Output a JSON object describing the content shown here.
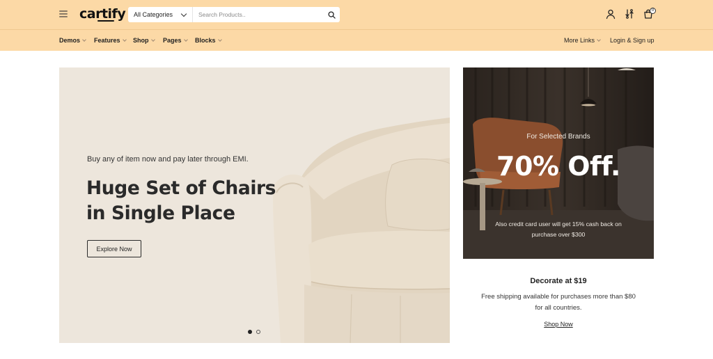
{
  "header": {
    "logo": "cartify",
    "category_select": "All Categories",
    "search_placeholder": "Search Products..",
    "cart_count": "0"
  },
  "nav": {
    "left": [
      {
        "label": "Demos"
      },
      {
        "label": "Features"
      },
      {
        "label": "Shop"
      },
      {
        "label": "Pages"
      },
      {
        "label": "Blocks"
      }
    ],
    "more_links": "More Links",
    "login": "Login & Sign up"
  },
  "hero": {
    "kicker": "Buy any of item now and pay later through EMI.",
    "title_line1": "Huge Set of Chairs",
    "title_line2": "in Single Place",
    "button": "Explore Now",
    "slides": 2,
    "active_slide": 1
  },
  "promo": {
    "kicker": "For Selected Brands",
    "headline": "70% Off.",
    "note": "Also credit card user will get 15% cash back on purchase over $300"
  },
  "side": {
    "title": "Decorate at $19",
    "text": "Free shipping available for purchases more than $80 for all countries.",
    "link": "Shop Now"
  },
  "colors": {
    "header_bg": "#fcd9a6",
    "hero_bg": "#ede6dc",
    "promo_bg": "#2e2621"
  }
}
